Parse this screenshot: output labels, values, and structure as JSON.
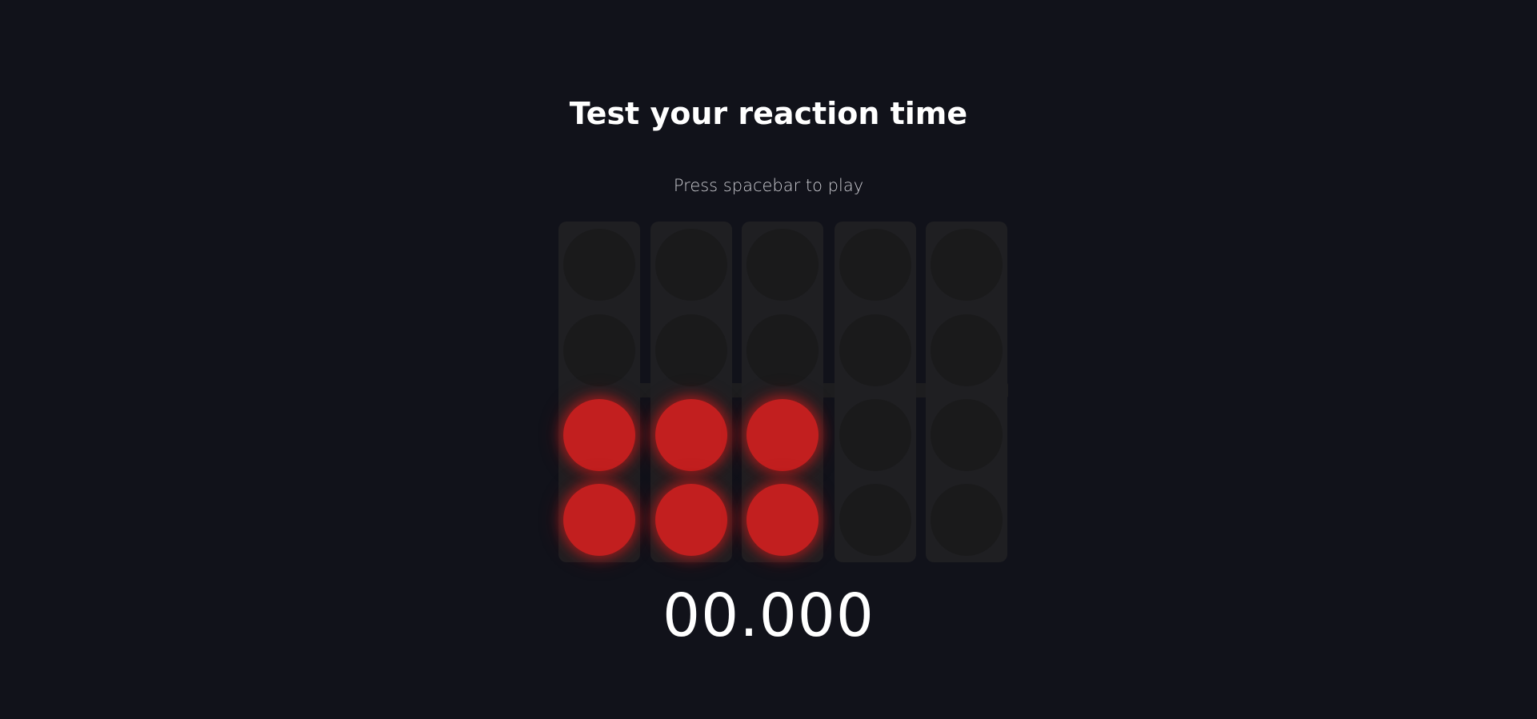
{
  "header": {
    "title": "Test your reaction time",
    "instruction": "Press spacebar to play"
  },
  "timer": {
    "display": "00.000"
  },
  "lights": {
    "columns": 5,
    "rows_per_column": 4,
    "lit_columns": 3,
    "lit_rows": "bottom two",
    "on_color": "#c21f1f",
    "off_color": "#1a1a1b",
    "panel_color": "#1f1f22",
    "background_color": "#11121a"
  }
}
